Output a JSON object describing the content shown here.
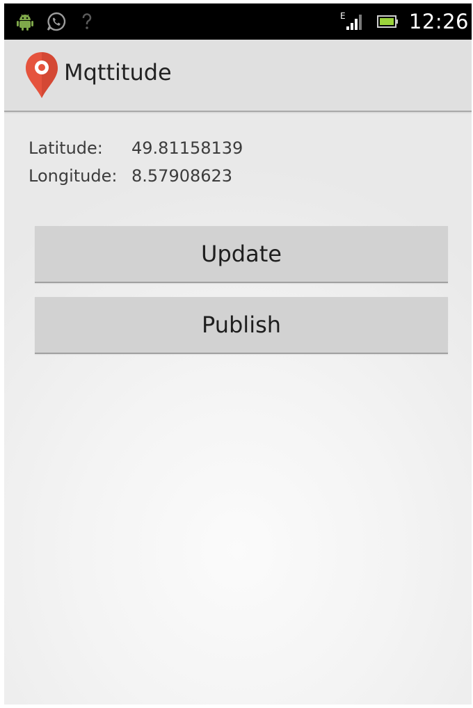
{
  "status_bar": {
    "time": "12:26",
    "network_type": "E",
    "left_icons": [
      "android-debug-icon",
      "whatsapp-icon",
      "wifi-question-icon"
    ],
    "right_icons": [
      "signal-icon",
      "battery-icon"
    ]
  },
  "action_bar": {
    "title": "Mqttitude",
    "icon": "map-pin-icon",
    "accent_color": "#e5533d"
  },
  "location": {
    "latitude_label": "Latitude:",
    "latitude_value": "49.81158139",
    "longitude_label": "Longitude:",
    "longitude_value": "8.57908623"
  },
  "buttons": {
    "update_label": "Update",
    "publish_label": "Publish"
  }
}
